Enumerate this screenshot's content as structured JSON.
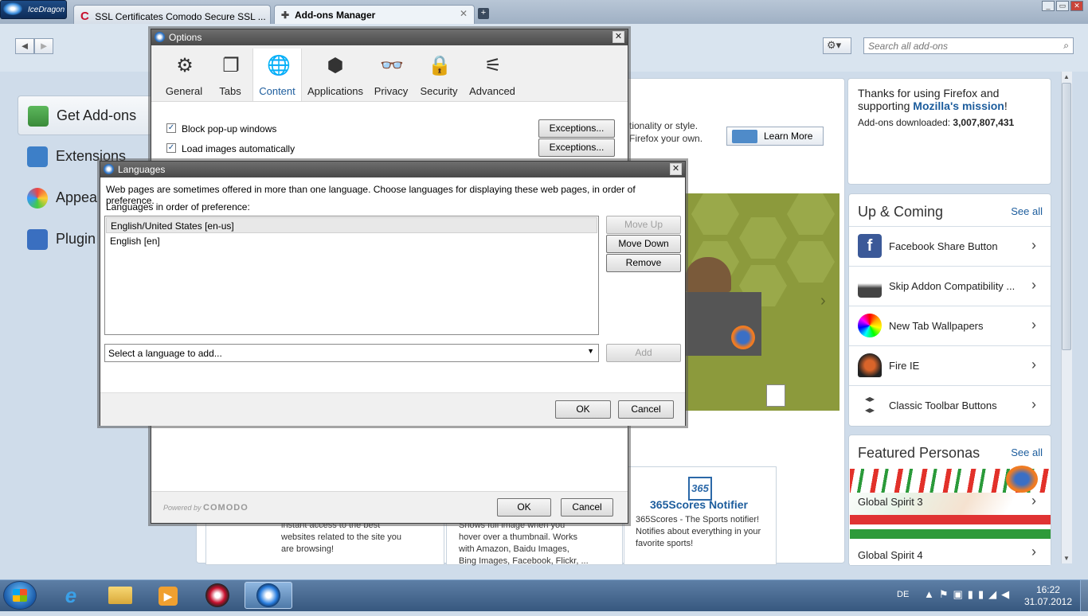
{
  "browser": {
    "brand_tab": "IceDragon",
    "tabs": [
      {
        "label": "SSL Certificates Comodo Secure SSL ..."
      },
      {
        "label": "Add-ons Manager"
      }
    ],
    "new_tab": "+",
    "window_controls": [
      "_",
      "▭",
      "✕"
    ]
  },
  "toolbar": {
    "back": "◄",
    "forward": "►",
    "search_placeholder": "Search all add-ons",
    "gear": "⚙▾"
  },
  "addons_nav": {
    "items": [
      {
        "label": "Get Add-ons"
      },
      {
        "label": "Extensions"
      },
      {
        "label": "Appea"
      },
      {
        "label": "Plugin"
      }
    ]
  },
  "thanks": {
    "line1": "Thanks for using Firefox and",
    "line2": "supporting ",
    "mission": "Mozilla's mission",
    "excl": "!",
    "downloaded_label": "Add-ons downloaded: ",
    "downloaded_value": "3,007,807,431"
  },
  "ad": {
    "text1": "tionality or style.",
    "text2": "Firefox your own.",
    "learn_more": "Learn More"
  },
  "up_coming": {
    "title": "Up & Coming",
    "see_all": "See all",
    "items": [
      {
        "label": "Facebook Share Button"
      },
      {
        "label": "Skip Addon Compatibility ..."
      },
      {
        "label": "New Tab Wallpapers"
      },
      {
        "label": "Fire IE"
      },
      {
        "label": "Classic Toolbar Buttons"
      }
    ]
  },
  "featured_personas": {
    "title": "Featured Personas",
    "see_all": "See all",
    "items": [
      {
        "label": "Global Spirit 3"
      },
      {
        "label": "Global Spirit 4"
      }
    ]
  },
  "cards": {
    "card1": "instant access to the best\nwebsites related to the site you\nare browsing!",
    "card2": "Shows full image when you\nhover over a thumbnail. Works\nwith Amazon, Baidu Images,\nBing Images, Facebook, Flickr, ...",
    "scores_logo": "365",
    "scores_title": "365Scores Notifier",
    "scores_desc": "365Scores - The Sports notifier!\nNotifies about everything in your\nfavorite sports!"
  },
  "options": {
    "title": "Options",
    "tabs": [
      {
        "label": "General",
        "icon": "⚙"
      },
      {
        "label": "Tabs",
        "icon": "❐"
      },
      {
        "label": "Content",
        "icon": "🌐"
      },
      {
        "label": "Applications",
        "icon": "⬢"
      },
      {
        "label": "Privacy",
        "icon": "👓"
      },
      {
        "label": "Security",
        "icon": "🔒"
      },
      {
        "label": "Advanced",
        "icon": "⚟"
      }
    ],
    "block_popups": "Block pop-up windows",
    "load_images": "Load images automatically",
    "exceptions": "Exceptions...",
    "powered_by": "Powered by ",
    "powered_brand": "COMODO",
    "ok": "OK",
    "cancel": "Cancel"
  },
  "languages": {
    "title": "Languages",
    "description": "Web pages are sometimes offered in more than one language. Choose languages for displaying these web pages, in order of preference.",
    "list_label": "Languages in order of preference:",
    "list": [
      {
        "label": "English/United States  [en-us]"
      },
      {
        "label": "English  [en]"
      }
    ],
    "move_up": "Move Up",
    "move_down": "Move Down",
    "remove": "Remove",
    "select_placeholder": "Select a language to add...",
    "add": "Add",
    "ok": "OK",
    "cancel": "Cancel"
  },
  "taskbar": {
    "language": "DE",
    "time": "16:22",
    "date": "31.07.2012"
  }
}
